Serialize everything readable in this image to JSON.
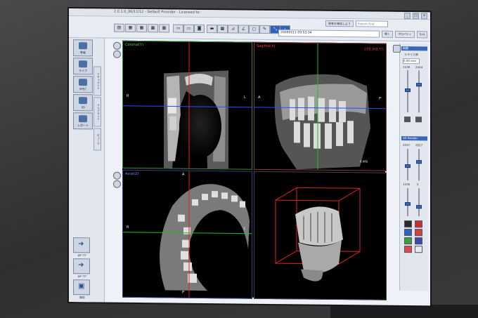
{
  "window": {
    "title": "2.0.1.0_06/11/12 - Default Provider - Licensed to:"
  },
  "header": {
    "search_button": "患者を確認しよう",
    "patient_placeholder": "Patient Find",
    "date_value": "20090511 09:53:04",
    "buttons": [
      "開く",
      "プロパティ",
      "Exit"
    ]
  },
  "sidebar": {
    "items": [
      {
        "label": "患者",
        "icon": "patient-folder-icon"
      },
      {
        "label": "ライブ",
        "icon": "person-icon"
      },
      {
        "label": "SPEC",
        "icon": "device-icon"
      },
      {
        "label": "3D",
        "icon": "monitor-icon"
      },
      {
        "label": "レポート",
        "icon": "report-icon"
      }
    ],
    "tabs": [
      "ドキュメント",
      "インプラント",
      "ビューア"
    ],
    "bottom": [
      {
        "label": "AP ??°",
        "icon": "rotate-left-icon"
      },
      {
        "label": "AP ??°",
        "icon": "rotate-right-icon"
      },
      {
        "label": "保存",
        "icon": "save-icon"
      }
    ]
  },
  "viewports": {
    "coronal": {
      "label": "Coronal(Y)",
      "color": "#5bd35b",
      "left": "R",
      "right": "L"
    },
    "sagittal": {
      "label": "Sagittal(X)",
      "color": "#e84a3a",
      "right_top": "233.3(0.??)",
      "left": "A",
      "right": "P",
      "bottom_right": "0.965"
    },
    "axial": {
      "label": "Axial(Z)",
      "color": "#6a8aff",
      "top": "A",
      "left": "R",
      "right": "L",
      "bottom": "P"
    },
    "volume": {
      "label": ""
    }
  },
  "right_panel": {
    "section1": "調整",
    "slice_label": "スライス厚",
    "slice_value": "0.00 mm",
    "wl": [
      "1106",
      "2404"
    ],
    "section2": "3D Render",
    "render_values": [
      "2037",
      "2827",
      "1106",
      "5"
    ]
  },
  "colors": {
    "accent": "#2f63b8",
    "crosshair_blue": "#2050ff",
    "crosshair_green": "#20c020",
    "bbox_red": "#e02020"
  }
}
